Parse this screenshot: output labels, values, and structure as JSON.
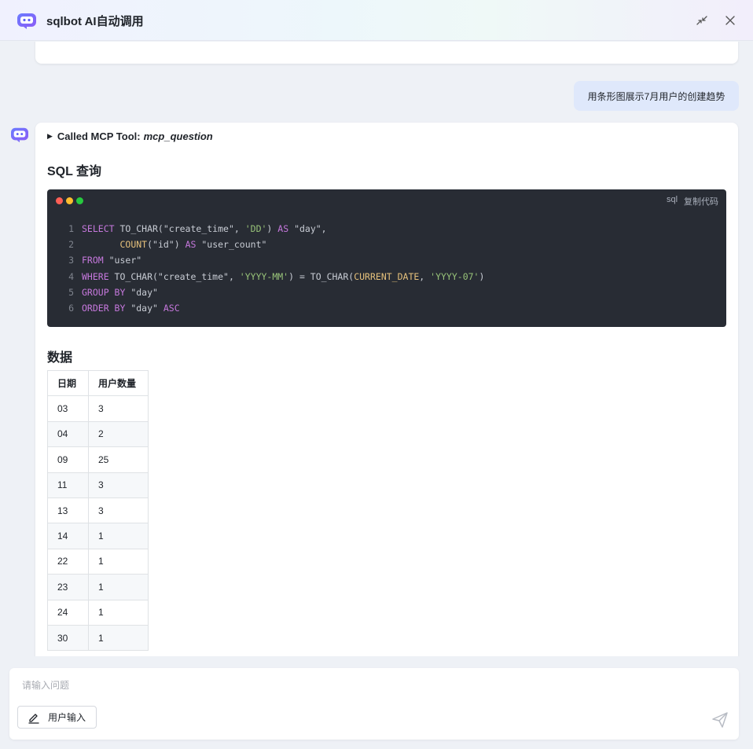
{
  "header": {
    "title": "sqlbot AI自动调用",
    "logo_icon": "robot-icon",
    "minimize_icon": "collapse-arrows-icon",
    "close_icon": "close-icon"
  },
  "chat": {
    "user_message": "用条形图展示7月用户的创建趋势",
    "tool_call": {
      "prefix": "Called MCP Tool:",
      "name": "mcp_question"
    },
    "sql_heading": "SQL 查询",
    "code": {
      "lang": "sql",
      "copy_label": "复制代码",
      "lines": [
        {
          "n": "1",
          "tokens": [
            [
              "kw",
              "SELECT"
            ],
            [
              "id",
              " TO_CHAR(\"create_time\", "
            ],
            [
              "str",
              "'DD'"
            ],
            [
              "id",
              ") "
            ],
            [
              "kw",
              "AS"
            ],
            [
              "id",
              " \"day\","
            ]
          ]
        },
        {
          "n": "2",
          "tokens": [
            [
              "id",
              "       "
            ],
            [
              "fn",
              "COUNT"
            ],
            [
              "id",
              "(\"id\") "
            ],
            [
              "kw",
              "AS"
            ],
            [
              "id",
              " \"user_count\""
            ]
          ]
        },
        {
          "n": "3",
          "tokens": [
            [
              "kw",
              "FROM"
            ],
            [
              "id",
              " \"user\""
            ]
          ]
        },
        {
          "n": "4",
          "tokens": [
            [
              "kw",
              "WHERE"
            ],
            [
              "id",
              " TO_CHAR(\"create_time\", "
            ],
            [
              "str",
              "'YYYY-MM'"
            ],
            [
              "id",
              ") = TO_CHAR("
            ],
            [
              "fn",
              "CURRENT_DATE"
            ],
            [
              "id",
              ", "
            ],
            [
              "str",
              "'YYYY-07'"
            ],
            [
              "id",
              ")"
            ]
          ]
        },
        {
          "n": "5",
          "tokens": [
            [
              "kw",
              "GROUP BY"
            ],
            [
              "id",
              " \"day\""
            ]
          ]
        },
        {
          "n": "6",
          "tokens": [
            [
              "kw",
              "ORDER BY"
            ],
            [
              "id",
              " \"day\" "
            ],
            [
              "kw",
              "ASC"
            ]
          ]
        }
      ],
      "dot_colors": [
        "#ff5f56",
        "#ffbd2e",
        "#27c93f"
      ]
    },
    "data_heading": "数据",
    "table": {
      "headers": [
        "日期",
        "用户数量"
      ],
      "rows": [
        [
          "03",
          "3"
        ],
        [
          "04",
          "2"
        ],
        [
          "09",
          "25"
        ],
        [
          "11",
          "3"
        ],
        [
          "13",
          "3"
        ],
        [
          "14",
          "1"
        ],
        [
          "22",
          "1"
        ],
        [
          "23",
          "1"
        ],
        [
          "24",
          "1"
        ],
        [
          "30",
          "1"
        ]
      ]
    }
  },
  "input": {
    "placeholder": "请输入问题",
    "user_input_label": "用户输入",
    "send_icon": "send-icon"
  },
  "colors": {
    "accent": "#5b5ff6",
    "code_bg": "#282c34",
    "user_bubble": "#dfe8fb"
  }
}
